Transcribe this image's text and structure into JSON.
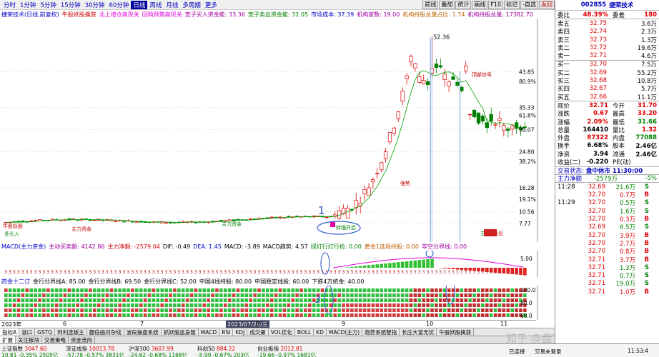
{
  "periods": [
    "分时",
    "1分钟",
    "5分钟",
    "15分钟",
    "30分钟",
    "60分钟",
    "日线",
    "周线",
    "月线",
    "多周期",
    "更多"
  ],
  "active_period": "日线",
  "mini_buttons": [
    "前线",
    "叠加",
    "统计",
    "画线",
    "F10",
    "标记",
    "-自选",
    "返回"
  ],
  "chart_header": {
    "stock": "捷荣技术(日线,前复权)",
    "items": [
      {
        "text": "牛股妖股擒获",
        "color": "red"
      },
      {
        "text": "北上增仓高现关",
        "color": "mag"
      },
      {
        "text": "回购预策高现关",
        "color": "mag"
      },
      {
        "text": "宽子买入资金能: 33.36",
        "color": "purple"
      },
      {
        "text": "宽子卖出资金能: 32.05",
        "color": "green"
      },
      {
        "text": "市场成本: 37.39",
        "color": "blue"
      },
      {
        "text": "机构家数: 19.00",
        "color": "purple"
      },
      {
        "text": "机构持股总量占比: 1.74",
        "color": "orange"
      },
      {
        "text": "机构持股总量: 17382.70",
        "color": "purple"
      }
    ]
  },
  "chart_data": {
    "type": "candlestick",
    "y_ticks": [
      "43.85",
      "35.33",
      "30.07",
      "24.80",
      "16.28",
      "10.56",
      "7.77"
    ],
    "pct_ticks": [
      "80.9%",
      "61.8%",
      "38.2%",
      "19.1%"
    ],
    "peak_label": "52.36",
    "annotations": [
      {
        "text": "1",
        "color": "#3050c0"
      },
      {
        "text": "2",
        "color": "#3050c0"
      },
      {
        "text": "3",
        "color": "#3050c0"
      }
    ],
    "chart_texts": [
      "牛股妖股",
      "多头入",
      "主力资金",
      "主力资金",
      "强势",
      "转强开启",
      "顶部信号",
      "主力出",
      "卖出"
    ]
  },
  "macd_header": {
    "items": [
      {
        "text": "MACD(主力资金)",
        "color": "blue"
      },
      {
        "text": "主动买卖额: 4142.86",
        "color": "purple"
      },
      {
        "text": "主力净额: -2579.04",
        "color": "red"
      },
      {
        "text": "DIF: -0.49",
        "color": "black"
      },
      {
        "text": "DEA: 1.45",
        "color": "blue"
      },
      {
        "text": "MACD: -3.89",
        "color": "black"
      },
      {
        "text": "MACD趋势: 4.57",
        "color": "black"
      },
      {
        "text": "绿灯行灯行检: 0.00",
        "color": "green"
      },
      {
        "text": "黄金1选场持股: 0.00",
        "color": "orange"
      },
      {
        "text": "非空分界线: 0.00",
        "color": "purple"
      }
    ],
    "y_tick": "5.00"
  },
  "ind_header": {
    "items": [
      {
        "text": "四金十二订",
        "color": "blue"
      },
      {
        "text": "金行分界线A: 85.00",
        "color": "black"
      },
      {
        "text": "金行分界线B: 69.50",
        "color": "black"
      },
      {
        "text": "金行分界线C: 52.00",
        "color": "black"
      },
      {
        "text": "中国4线持股: 80.00",
        "color": "black"
      },
      {
        "text": "中国稳定线股: 60.00",
        "color": "black"
      },
      {
        "text": "下跌4万统金: 40.00",
        "color": "black"
      }
    ],
    "y_ticks": [
      "100.0",
      "80.0",
      "60.0"
    ]
  },
  "dates": {
    "year_label": "2023年",
    "items": [
      "6",
      "7",
      "2023/07/26/三",
      "8",
      "9",
      "10",
      "11"
    ],
    "selected": "2023/07/26/三"
  },
  "tabs1": [
    "指标A",
    "滋口",
    "GSTQ",
    "阿利选板主",
    "翻倍画对杂线",
    "波段操盘系统",
    "抓妖股追身躯",
    "MACD",
    "RSI",
    "KDJ",
    "成交量",
    "VOL优化",
    "BOLL",
    "KD",
    "MACD(主力)",
    "趋势系统智指",
    "长庄大富无忧",
    "牛股妖股擒获"
  ],
  "tabs2": [
    "扩展",
    "关注板块",
    "交易策略",
    "资金流向"
  ],
  "status_bar": {
    "row1": [
      {
        "label": "上证指数",
        "value": "3047.60",
        "extra": "",
        "color": "red"
      },
      {
        "label": "深证成指",
        "value": "10013.78",
        "extra": "",
        "color": "red"
      },
      {
        "label": "沪深300",
        "value": "3607.99",
        "extra": "",
        "color": "red"
      },
      {
        "label": "科创50",
        "value": "884.22",
        "extra": "",
        "color": "red"
      },
      {
        "label": "创业板指",
        "value": "2012.81",
        "extra": "",
        "color": "red"
      }
    ],
    "row2": [
      {
        "text": "10.81 -0.35% 2505亿",
        "color": "green"
      },
      {
        "text": "-57.78 -0.57% 3831亿",
        "color": "green"
      },
      {
        "text": "-24.62 -0.68% 1168亿",
        "color": "green"
      },
      {
        "text": "-5.99 -0.67% 203亿",
        "color": "green"
      },
      {
        "text": "-19.66 -0.97% 1681亿",
        "color": "green"
      }
    ],
    "connection": "已连接",
    "trade": "交易未登录",
    "time": "11:53:4"
  },
  "watermark": "知乎 @盘飞云",
  "right_panel": {
    "code": "002855",
    "name": "捷荣技术",
    "weibi_label": "委比",
    "weibi": "48.39%",
    "weicha_label": "委差",
    "weicha": "180",
    "asks": [
      {
        "label": "卖五",
        "price": "32.75",
        "vol": "3.6万"
      },
      {
        "label": "卖四",
        "price": "32.74",
        "vol": "2.3万"
      },
      {
        "label": "卖三",
        "price": "32.73",
        "vol": "1.3万"
      },
      {
        "label": "卖二",
        "price": "32.72",
        "vol": "19.6万"
      },
      {
        "label": "卖一",
        "price": "32.71",
        "vol": "4.6万"
      }
    ],
    "bids": [
      {
        "label": "买一",
        "price": "32.70",
        "vol": "7.5万"
      },
      {
        "label": "买二",
        "price": "32.69",
        "vol": "55.2万"
      },
      {
        "label": "买三",
        "price": "32.68",
        "vol": "10.8万"
      },
      {
        "label": "买四",
        "price": "32.67",
        "vol": "5.7万"
      },
      {
        "label": "买五",
        "price": "32.66",
        "vol": "11.1万"
      }
    ],
    "quote": [
      {
        "l1": "现价",
        "v1": "32.71",
        "l2": "今开",
        "v2": "31.70",
        "c1": "red",
        "c2": "red"
      },
      {
        "l1": "涨跌",
        "v1": "0.67",
        "l2": "最高",
        "v2": "33.20",
        "c1": "red",
        "c2": "red"
      },
      {
        "l1": "涨幅",
        "v1": "2.09%",
        "l2": "最低",
        "v2": "31.66",
        "c1": "red",
        "c2": "green"
      },
      {
        "l1": "总量",
        "v1": "164410",
        "l2": "量比",
        "v2": "1.32",
        "c1": "black",
        "c2": "red"
      },
      {
        "l1": "外盘",
        "v1": "87322",
        "l2": "内盘",
        "v2": "77088",
        "c1": "red",
        "c2": "green"
      },
      {
        "l1": "换手",
        "v1": "6.68%",
        "l2": "股本",
        "v2": "2.46亿",
        "c1": "black",
        "c2": "black"
      },
      {
        "l1": "净资",
        "v1": "3.94",
        "l2": "流通",
        "v2": "2.46亿",
        "c1": "black",
        "c2": "black"
      }
    ],
    "earn_label": "收益(二)",
    "earn": "-0.220",
    "pe_label": "PE(动)",
    "pe": "",
    "trade_state_label": "交易状态:",
    "trade_state": "盘中休市 11:30:00",
    "main_net_label": "主力净额",
    "main_net": "-2579万",
    "main_net_pct": "-5%",
    "ticks": [
      {
        "t": "11:28",
        "p": "32.69",
        "v": "21.6万",
        "s": "S"
      },
      {
        "t": "",
        "p": "32.70",
        "v": "0.7万",
        "s": "B"
      },
      {
        "t": "11:29",
        "p": "32.70",
        "v": "0.5万",
        "s": "S"
      },
      {
        "t": "",
        "p": "32.70",
        "v": "1.6万",
        "s": "S"
      },
      {
        "t": "",
        "p": "32.70",
        "v": "0.3万",
        "s": "B"
      },
      {
        "t": "",
        "p": "32.69",
        "v": "6.5万",
        "s": "S"
      },
      {
        "t": "",
        "p": "32.70",
        "v": "3.9万",
        "s": "B"
      },
      {
        "t": "",
        "p": "32.70",
        "v": "2.7万",
        "s": "B"
      },
      {
        "t": "",
        "p": "32.70",
        "v": "0.8万",
        "s": "B"
      },
      {
        "t": "",
        "p": "32.71",
        "v": "3.7万",
        "s": "B"
      },
      {
        "t": "",
        "p": "32.71",
        "v": "1.3万",
        "s": "S"
      },
      {
        "t": "",
        "p": "32.71",
        "v": "0.7万",
        "s": "S"
      },
      {
        "t": "",
        "p": "32.71",
        "v": "19.0万",
        "s": "S"
      },
      {
        "t": "",
        "p": "32.71",
        "v": "1.0万",
        "s": "B"
      }
    ]
  },
  "colors": {
    "up": "#e00000",
    "down": "#008000",
    "bg": "#ffffff",
    "grid": "#d0d0d0"
  }
}
